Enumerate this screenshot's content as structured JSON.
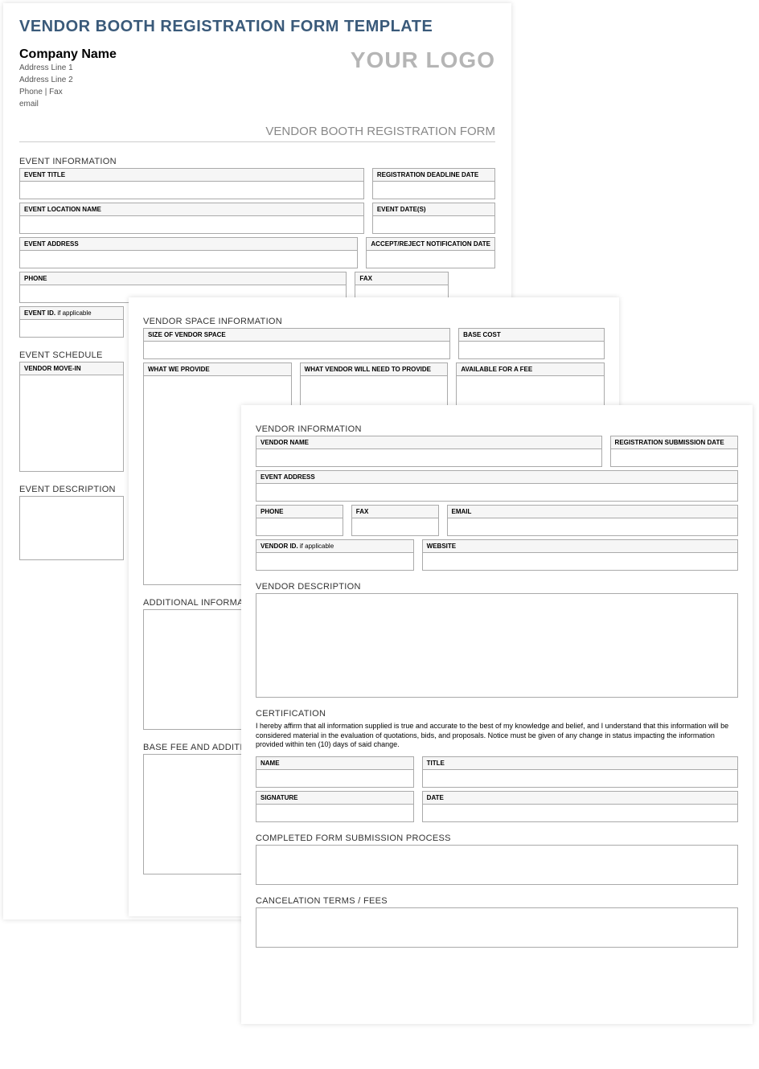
{
  "mainTitle": "VENDOR BOOTH REGISTRATION FORM TEMPLATE",
  "company": {
    "name": "Company Name",
    "addr1": "Address Line 1",
    "addr2": "Address Line 2",
    "phoneFax": "Phone | Fax",
    "email": "email"
  },
  "logo": "YOUR LOGO",
  "subtitle": "VENDOR BOOTH REGISTRATION FORM",
  "sections": {
    "eventInfo": "EVENT INFORMATION",
    "eventSchedule": "EVENT SCHEDULE",
    "eventDescription": "EVENT DESCRIPTION",
    "vendorSpace": "VENDOR SPACE INFORMATION",
    "additionalInfo": "ADDITIONAL INFORMATION",
    "baseFee": "BASE FEE AND ADDITIONAL",
    "vendorInfo": "VENDOR INFORMATION",
    "vendorDescription": "VENDOR DESCRIPTION",
    "certification": "CERTIFICATION",
    "submission": "COMPLETED FORM SUBMISSION PROCESS",
    "cancellation": "CANCELATION TERMS / FEES"
  },
  "labels": {
    "eventTitle": "EVENT TITLE",
    "regDeadline": "REGISTRATION DEADLINE DATE",
    "eventLocation": "EVENT LOCATION NAME",
    "eventDates": "EVENT DATE(S)",
    "eventAddress": "EVENT ADDRESS",
    "acceptReject": "ACCEPT/REJECT NOTIFICATION DATE",
    "phone": "PHONE",
    "fax": "FAX",
    "eventId": "EVENT ID.",
    "ifApplicable": " if applicable",
    "vendorMoveIn": "VENDOR MOVE-IN",
    "sizeVendor": "SIZE OF VENDOR SPACE",
    "baseCost": "BASE COST",
    "whatWeProvide": "WHAT WE PROVIDE",
    "whatVendorProvide": "WHAT VENDOR WILL NEED TO PROVIDE",
    "availableFee": "AVAILABLE FOR A FEE",
    "vendorName": "VENDOR NAME",
    "regSubmission": "REGISTRATION SUBMISSION DATE",
    "email": "EMAIL",
    "vendorId": "VENDOR ID.",
    "website": "WEBSITE",
    "name": "NAME",
    "title": "TITLE",
    "signature": "SIGNATURE",
    "date": "DATE"
  },
  "certText": "I hereby affirm that all information supplied is true and accurate to the best of my knowledge and belief, and I understand that this information will be considered material in the evaluation of quotations, bids, and proposals. Notice must be given of any change in status impacting the information provided within ten (10) days of said change."
}
